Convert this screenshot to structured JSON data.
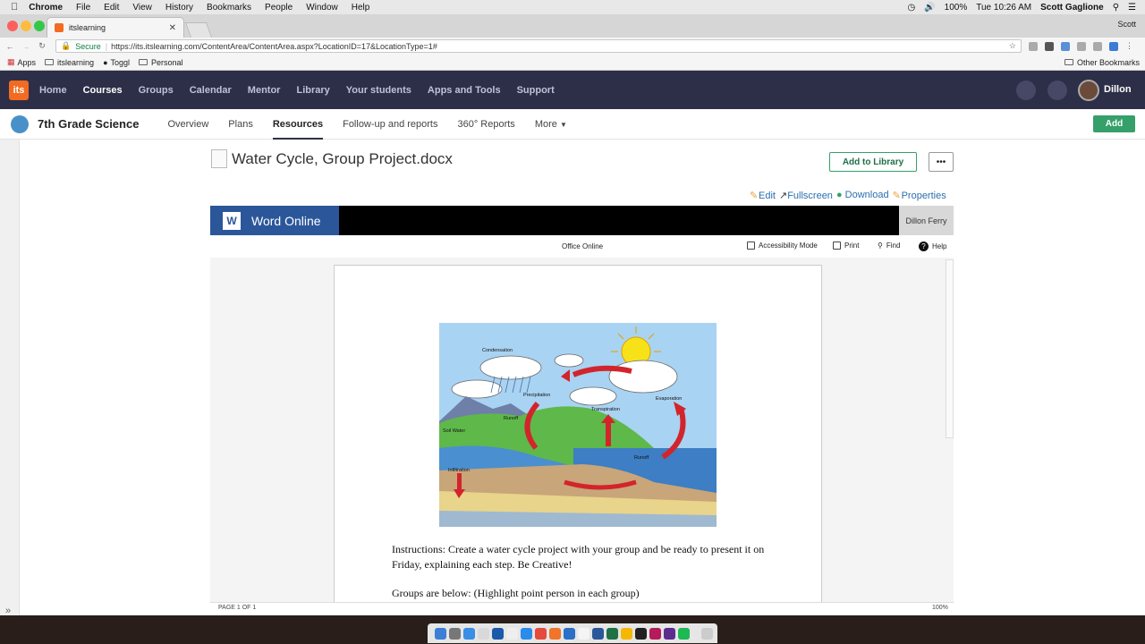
{
  "menubar": {
    "items": [
      "Chrome",
      "File",
      "Edit",
      "View",
      "History",
      "Bookmarks",
      "People",
      "Window",
      "Help"
    ],
    "battery": "100%",
    "clock": "Tue 10:26 AM",
    "user": "Scott Gaglione"
  },
  "browser": {
    "tab_title": "itslearning",
    "profile": "Scott",
    "secure_label": "Secure",
    "url": "https://its.itslearning.com/ContentArea/ContentArea.aspx?LocationID=17&LocationType=1#",
    "bookmarks": [
      "Apps",
      "itslearning",
      "Toggl",
      "Personal"
    ],
    "other_bookmarks": "Other Bookmarks"
  },
  "topnav": {
    "logo": "its",
    "items": [
      "Home",
      "Courses",
      "Groups",
      "Calendar",
      "Mentor",
      "Library",
      "Your students",
      "Apps and Tools",
      "Support"
    ],
    "active": "Courses",
    "user": "Dillon"
  },
  "course": {
    "name": "7th Grade Science",
    "tabs": [
      "Overview",
      "Plans",
      "Resources",
      "Follow-up and reports",
      "360° Reports",
      "More"
    ],
    "active": "Resources",
    "add_label": "Add"
  },
  "document": {
    "title": "Water Cycle, Group Project.docx",
    "add_to_library": "Add to Library",
    "more": "•••",
    "links": [
      "Edit",
      "Fullscreen",
      "Download",
      "Properties"
    ]
  },
  "word_online": {
    "brand": "Word Online",
    "user": "Dillon Ferry",
    "office_online": "Office Online",
    "tools": [
      "Accessibility Mode",
      "Print",
      "Find",
      "Help"
    ],
    "image_labels": [
      "Condensation",
      "Precipitation",
      "Transpiration",
      "Evaporation",
      "Runoff",
      "Soil Water",
      "Infiltration",
      "Runoff"
    ],
    "instructions": "Instructions: Create a water cycle project with your group and be ready to present it on Friday, explaining each step. Be Creative!",
    "groups": "Groups are below: (Highlight point person in each group)",
    "page_status": "PAGE 1 OF 1",
    "zoom": "100%"
  },
  "colors": {
    "nav_bg": "#2d2f48",
    "brand_orange": "#f26b21",
    "add_green": "#35a06a",
    "word_blue": "#2b579a",
    "link_blue": "#2a6fb0"
  }
}
